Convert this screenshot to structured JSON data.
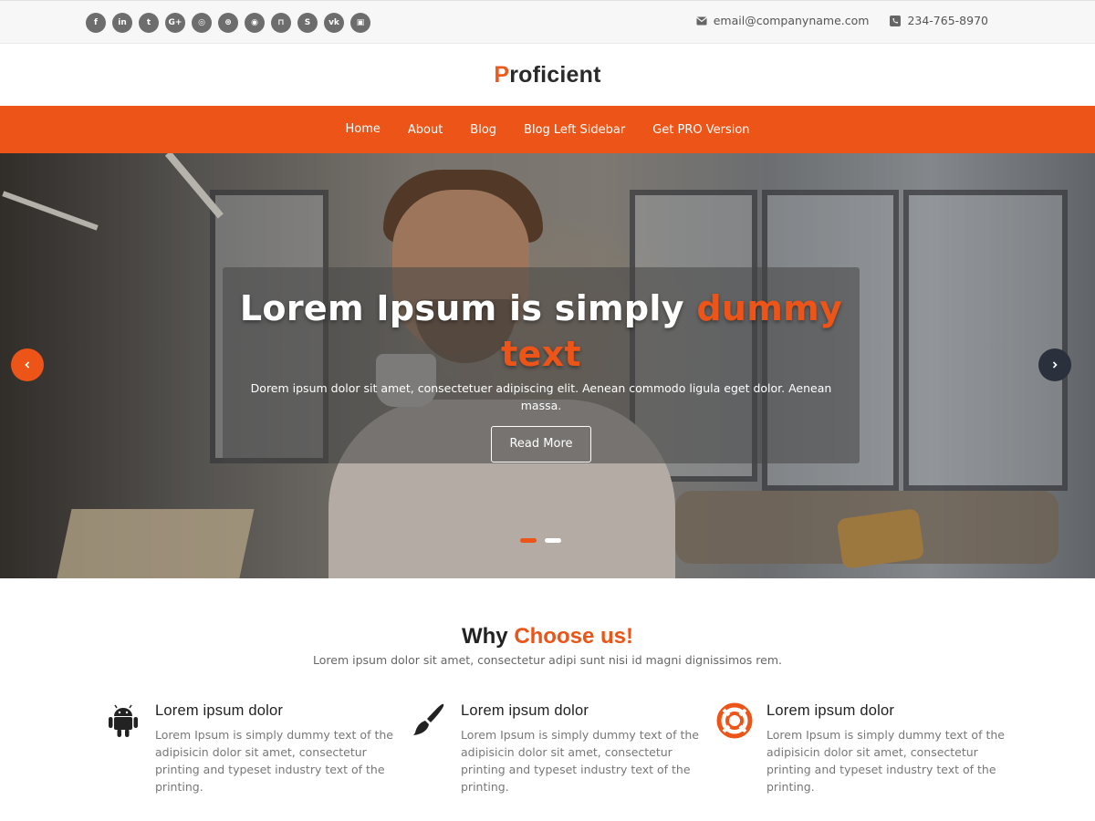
{
  "topbar": {
    "socials": [
      {
        "icon": "facebook-icon",
        "glyph": "f"
      },
      {
        "icon": "linkedin-icon",
        "glyph": "in"
      },
      {
        "icon": "twitter-icon",
        "glyph": "t"
      },
      {
        "icon": "google-plus-icon",
        "glyph": "G+"
      },
      {
        "icon": "instagram-icon",
        "glyph": "◎"
      },
      {
        "icon": "dribbble-icon",
        "glyph": "⊛"
      },
      {
        "icon": "github-icon",
        "glyph": "◉"
      },
      {
        "icon": "foursquare-icon",
        "glyph": "⊓"
      },
      {
        "icon": "skype-icon",
        "glyph": "S"
      },
      {
        "icon": "vk-icon",
        "glyph": "vk"
      },
      {
        "icon": "xing-icon",
        "glyph": "▣"
      }
    ],
    "email": "email@companyname.com",
    "phone": "234-765-8970"
  },
  "header": {
    "logo_first": "P",
    "logo_rest": "roficient"
  },
  "nav": {
    "items": [
      "Home",
      "About",
      "Blog",
      "Blog Left Sidebar",
      "Get PRO Version"
    ],
    "active": "Home"
  },
  "hero": {
    "title_plain": "Lorem Ipsum is simply ",
    "title_accent": "dummy text",
    "description": "Dorem ipsum dolor sit amet, consectetuer adipiscing elit. Aenean commodo ligula eget dolor. Aenean massa.",
    "button": "Read More",
    "slide_count": 2,
    "active_slide": 1
  },
  "why": {
    "title_plain": "Why ",
    "title_accent": "Choose us!",
    "subtitle": "Lorem ipsum dolor sit amet, consectetur adipi sunt nisi id magni dignissimos rem.",
    "features": [
      {
        "icon": "android-icon",
        "title": "Lorem ipsum dolor",
        "text": "Lorem Ipsum is simply dummy text of the adipisicin dolor sit amet, consectetur printing and typeset industry text of the printing."
      },
      {
        "icon": "paintbrush-icon",
        "title": "Lorem ipsum dolor",
        "text": "Lorem Ipsum is simply dummy text of the adipisicin dolor sit amet, consectetur printing and typeset industry text of the printing."
      },
      {
        "icon": "lifebuoy-icon",
        "title": "Lorem ipsum dolor",
        "text": "Lorem Ipsum is simply dummy text of the adipisicin dolor sit amet, consectetur printing and typeset industry text of the printing."
      }
    ]
  },
  "colors": {
    "accent": "#ec5418",
    "dark": "#2a313d",
    "topbar_bg": "#f7f7f7"
  }
}
